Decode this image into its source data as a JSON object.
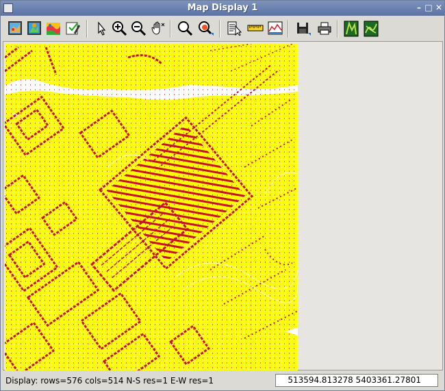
{
  "window": {
    "title": "Map Display 1",
    "controls": {
      "minimize": "–",
      "maximize": "□",
      "close": "✕"
    }
  },
  "toolbar": {
    "buttons": [
      {
        "name": "display-map-icon"
      },
      {
        "name": "redraw-icon"
      },
      {
        "name": "overlay-icon"
      },
      {
        "name": "erase-icon"
      },
      {
        "name": "pointer-icon"
      },
      {
        "name": "zoom-in-icon"
      },
      {
        "name": "zoom-out-icon"
      },
      {
        "name": "pan-icon"
      },
      {
        "name": "zoom-extent-icon"
      },
      {
        "name": "zoom-menu-icon"
      },
      {
        "name": "query-icon"
      },
      {
        "name": "measure-icon"
      },
      {
        "name": "profile-icon"
      },
      {
        "name": "save-icon"
      },
      {
        "name": "print-icon"
      },
      {
        "name": "map-2d-icon"
      },
      {
        "name": "map-3d-icon"
      }
    ]
  },
  "map": {
    "colors": {
      "background": "#ffff00",
      "features": "#c8102e",
      "nodata": "#ffffff"
    }
  },
  "statusbar": {
    "display_info": "Display: rows=576 cols=514 N-S res=1 E-W res=1",
    "coordinates": "513594.813278 5403361.27801"
  }
}
